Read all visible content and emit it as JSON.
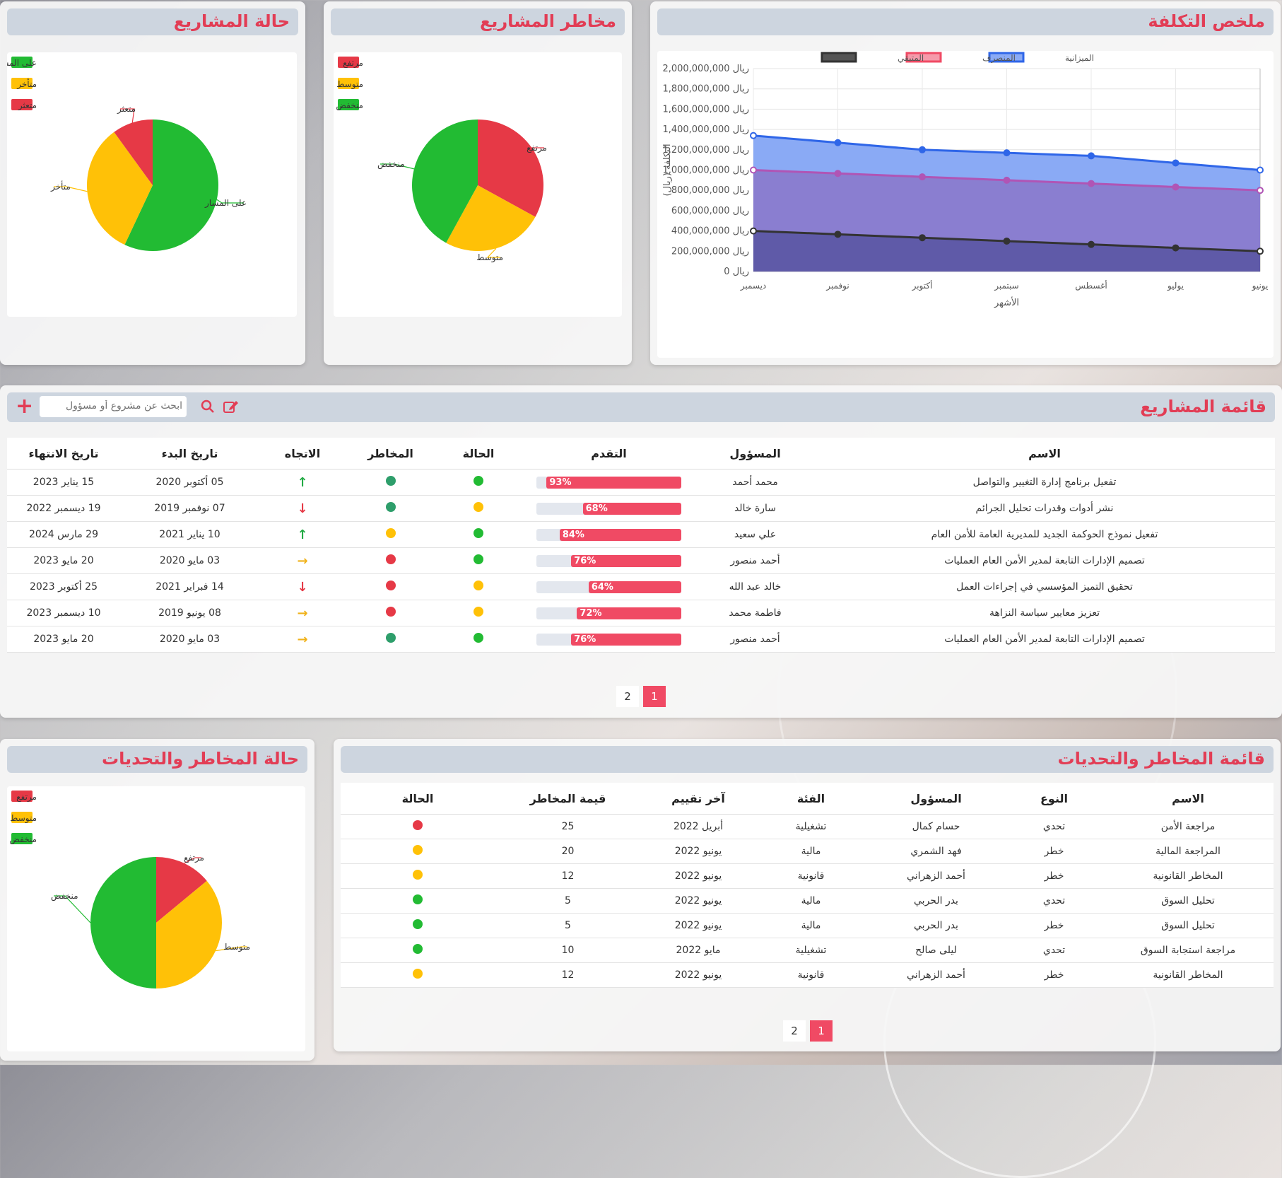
{
  "colors": {
    "green": "#22bb33",
    "yellow": "#ffc107",
    "red": "#e63946",
    "darkgreen": "#2e9e6b",
    "accent": "#f04a64"
  },
  "cost_panel": {
    "title": "ملخص التكلفة"
  },
  "risks_panel": {
    "title": "مخاطر المشاريع"
  },
  "status_panel": {
    "title": "حالة المشاريع"
  },
  "challenges_panel": {
    "title": "حالة المخاطر والتحديات"
  },
  "chart_data": [
    {
      "type": "area",
      "title": "",
      "xlabel": "الأشهر",
      "ylabel": "التكلفة (ريال)",
      "categories": [
        "يونيو",
        "يوليو",
        "أغسطس",
        "سبتمبر",
        "أكتوبر",
        "نوفمبر",
        "ديسمبر"
      ],
      "ylim": [
        0,
        2000000000
      ],
      "yticks": [
        "2,000,000,000 ريال",
        "1,800,000,000 ريال",
        "1,600,000,000 ريال",
        "1,400,000,000 ريال",
        "1,200,000,000 ريال",
        "1,000,000,000 ريال",
        "800,000,000 ريال",
        "600,000,000 ريال",
        "400,000,000 ريال",
        "200,000,000 ريال",
        "0 ريال"
      ],
      "legend_position": "top",
      "series": [
        {
          "name": "الميزانية",
          "color": "#2f66e8",
          "fill": "#8aaaf5",
          "values": [
            1000000000,
            1070000000,
            1140000000,
            1170000000,
            1200000000,
            1270000000,
            1340000000
          ]
        },
        {
          "name": "المنصرف",
          "color": "#b055b5",
          "fill": "#8a7ed0",
          "values": [
            800000000,
            833000000,
            867000000,
            900000000,
            933000000,
            967000000,
            1000000000
          ]
        },
        {
          "name": "المتبقي",
          "color": "#333333",
          "fill": "#5f5aa8",
          "values": [
            200000000,
            233000000,
            267000000,
            300000000,
            333000000,
            367000000,
            400000000
          ]
        }
      ],
      "legend_colors": [
        {
          "name": "الميزانية",
          "color": "#2f66e8",
          "fill": "#8aaaf5"
        },
        {
          "name": "المنصرف",
          "color": "#f04a64",
          "fill": "#f59aaa"
        },
        {
          "name": "المتبقي",
          "color": "#333333",
          "fill": "#555555"
        }
      ]
    },
    {
      "type": "pie",
      "legend": [
        {
          "label": "مرتفع",
          "color": "#e63946"
        },
        {
          "label": "متوسط",
          "color": "#ffc107"
        },
        {
          "label": "منخفض",
          "color": "#22bb33"
        }
      ],
      "slices": [
        {
          "label": "مرتفع",
          "value": 33,
          "color": "#e63946"
        },
        {
          "label": "متوسط",
          "value": 25,
          "color": "#ffc107"
        },
        {
          "label": "منخفض",
          "value": 42,
          "color": "#22bb33"
        }
      ]
    },
    {
      "type": "pie",
      "legend": [
        {
          "label": "على المسار",
          "color": "#22bb33"
        },
        {
          "label": "متأخر",
          "color": "#ffc107"
        },
        {
          "label": "متعثر",
          "color": "#e63946"
        }
      ],
      "slices": [
        {
          "label": "على المسار",
          "value": 57,
          "color": "#22bb33"
        },
        {
          "label": "متأخر",
          "value": 33,
          "color": "#ffc107"
        },
        {
          "label": "متعثر",
          "value": 10,
          "color": "#e63946"
        }
      ]
    },
    {
      "type": "pie",
      "legend": [
        {
          "label": "مرتفع",
          "color": "#e63946"
        },
        {
          "label": "متوسط",
          "color": "#ffc107"
        },
        {
          "label": "منخفض",
          "color": "#22bb33"
        }
      ],
      "slices": [
        {
          "label": "مرتفع",
          "value": 14,
          "color": "#e63946"
        },
        {
          "label": "متوسط",
          "value": 36,
          "color": "#ffc107"
        },
        {
          "label": "منخفض",
          "value": 50,
          "color": "#22bb33"
        }
      ]
    }
  ],
  "projects": {
    "title": "قائمة المشاريع",
    "search_placeholder": "ابحث عن مشروع أو مسؤول",
    "headers": [
      "الاسم",
      "المسؤول",
      "التقدم",
      "الحالة",
      "المخاطر",
      "الاتجاه",
      "تاريخ البدء",
      "تاريخ الانتهاء"
    ],
    "rows": [
      {
        "name": "تفعيل برنامج إدارة التغيير والتواصل",
        "owner": "محمد أحمد",
        "progress": 93,
        "progress_label": "93%",
        "status": "green",
        "risk": "darkgreen",
        "trend": "up",
        "start": "05 أكتوبر 2020",
        "end": "15 يناير 2023"
      },
      {
        "name": "نشر أدوات وقدرات تحليل الجرائم",
        "owner": "سارة خالد",
        "progress": 68,
        "progress_label": "68%",
        "status": "yellow",
        "risk": "darkgreen",
        "trend": "down",
        "start": "07 نوفمبر 2019",
        "end": "19 ديسمبر 2022"
      },
      {
        "name": "تفعيل نموذج الحوكمة الجديد للمديرية العامة للأمن العام",
        "owner": "علي سعيد",
        "progress": 84,
        "progress_label": "84%",
        "status": "green",
        "risk": "yellow",
        "trend": "up",
        "start": "10 يناير 2021",
        "end": "29 مارس 2024"
      },
      {
        "name": "تصميم الإدارات التابعة لمدير الأمن العام العمليات",
        "owner": "أحمد منصور",
        "progress": 76,
        "progress_label": "76%",
        "status": "green",
        "risk": "red",
        "trend": "right",
        "start": "03 مايو 2020",
        "end": "20 مايو 2023"
      },
      {
        "name": "تحقيق التميز المؤسسي في إجراءات العمل",
        "owner": "خالد عبد الله",
        "progress": 64,
        "progress_label": "64%",
        "status": "yellow",
        "risk": "red",
        "trend": "down",
        "start": "14 فبراير 2021",
        "end": "25 أكتوبر 2023"
      },
      {
        "name": "تعزيز معايير سياسة النزاهة",
        "owner": "فاطمة محمد",
        "progress": 72,
        "progress_label": "72%",
        "status": "yellow",
        "risk": "red",
        "trend": "right",
        "start": "08 يونيو 2019",
        "end": "10 ديسمبر 2023"
      },
      {
        "name": "تصميم الإدارات التابعة لمدير الأمن العام العمليات",
        "owner": "أحمد منصور",
        "progress": 76,
        "progress_label": "76%",
        "status": "green",
        "risk": "darkgreen",
        "trend": "right",
        "start": "03 مايو 2020",
        "end": "20 مايو 2023"
      }
    ],
    "pages": [
      "2",
      "1"
    ]
  },
  "risks_list": {
    "title": "قائمة المخاطر والتحديات",
    "headers": [
      "الاسم",
      "النوع",
      "المسؤول",
      "الفئة",
      "آخر تقييم",
      "قيمة المخاطر",
      "الحالة"
    ],
    "rows": [
      {
        "name": "مراجعة الأمن",
        "type": "تحدي",
        "owner": "حسام كمال",
        "category": "تشغيلية",
        "last": "أبريل 2022",
        "value": "25",
        "status": "red"
      },
      {
        "name": "المراجعة المالية",
        "type": "خطر",
        "owner": "فهد الشمري",
        "category": "مالية",
        "last": "يونيو 2022",
        "value": "20",
        "status": "yellow"
      },
      {
        "name": "المخاطر القانونية",
        "type": "خطر",
        "owner": "أحمد الزهراني",
        "category": "قانونية",
        "last": "يونيو 2022",
        "value": "12",
        "status": "yellow"
      },
      {
        "name": "تحليل السوق",
        "type": "تحدي",
        "owner": "بدر الحربي",
        "category": "مالية",
        "last": "يونيو 2022",
        "value": "5",
        "status": "green"
      },
      {
        "name": "تحليل السوق",
        "type": "خطر",
        "owner": "بدر الحربي",
        "category": "مالية",
        "last": "يونيو 2022",
        "value": "5",
        "status": "green"
      },
      {
        "name": "مراجعة استجابة السوق",
        "type": "تحدي",
        "owner": "ليلى صالح",
        "category": "تشغيلية",
        "last": "مايو 2022",
        "value": "10",
        "status": "green"
      },
      {
        "name": "المخاطر القانونية",
        "type": "خطر",
        "owner": "أحمد الزهراني",
        "category": "قانونية",
        "last": "يونيو 2022",
        "value": "12",
        "status": "yellow"
      }
    ],
    "pages": [
      "2",
      "1"
    ]
  }
}
